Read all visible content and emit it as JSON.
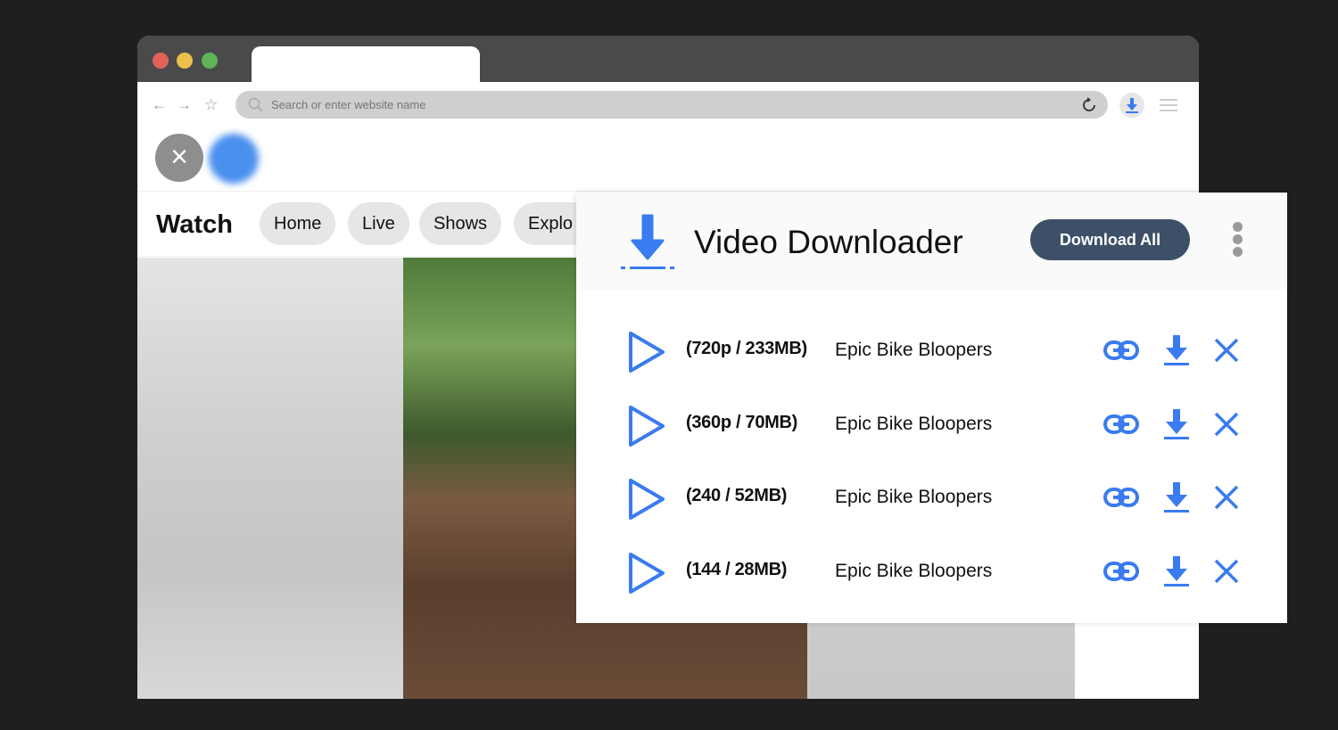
{
  "browser": {
    "address_placeholder": "Search or enter website name",
    "icons": [
      "back-arrow-icon",
      "forward-arrow-icon",
      "star-icon",
      "search-icon",
      "reload-icon",
      "download-extension-icon",
      "menu-icon"
    ]
  },
  "page": {
    "title": "Watch",
    "tabs": [
      "Home",
      "Live",
      "Shows",
      "Explo"
    ]
  },
  "downloader": {
    "title": "Video Downloader",
    "download_all": "Download All",
    "accent": "#3a7bf0",
    "items": [
      {
        "quality": "(720p / 233MB)",
        "title": "Epic Bike Bloopers"
      },
      {
        "quality": "(360p / 70MB)",
        "title": "Epic Bike Bloopers"
      },
      {
        "quality": "(240 / 52MB)",
        "title": "Epic Bike Bloopers"
      },
      {
        "quality": "(144 / 28MB)",
        "title": "Epic Bike Bloopers"
      }
    ]
  }
}
